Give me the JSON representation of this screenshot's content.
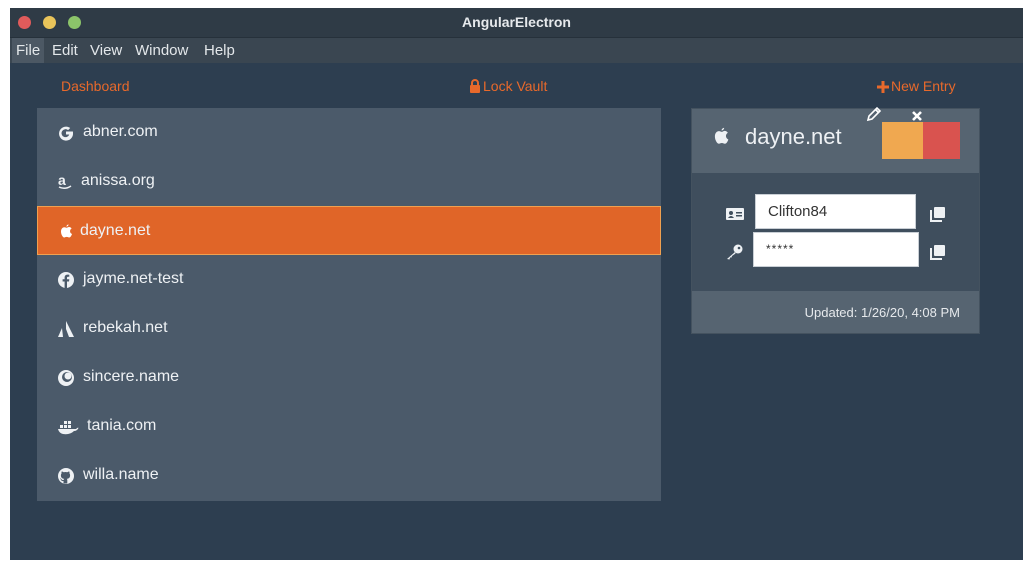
{
  "app": {
    "title": "AngularElectron"
  },
  "menu": [
    "File",
    "Edit",
    "View",
    "Window",
    "Help"
  ],
  "nav": {
    "dashboard": "Dashboard",
    "lock_vault": "Lock Vault",
    "new_entry": "New Entry"
  },
  "entries": [
    {
      "label": "abner.com",
      "icon": "google-icon"
    },
    {
      "label": "anissa.org",
      "icon": "amazon-icon"
    },
    {
      "label": "dayne.net",
      "icon": "apple-icon",
      "selected": true
    },
    {
      "label": "jayme.net-test",
      "icon": "facebook-icon"
    },
    {
      "label": "rebekah.net",
      "icon": "atlassian-icon"
    },
    {
      "label": "sincere.name",
      "icon": "firefox-icon"
    },
    {
      "label": "tania.com",
      "icon": "docker-icon"
    },
    {
      "label": "willa.name",
      "icon": "github-icon"
    }
  ],
  "detail": {
    "name": "dayne.net",
    "icon": "apple-icon",
    "username": "Clifton84",
    "password": "*****",
    "updated": "Updated: 1/26/20, 4:08 PM"
  },
  "colors": {
    "accent": "#e8692b",
    "background": "#2d3e50",
    "list": "#4b5a6a",
    "edit": "#f0a850",
    "delete": "#d9534f"
  }
}
